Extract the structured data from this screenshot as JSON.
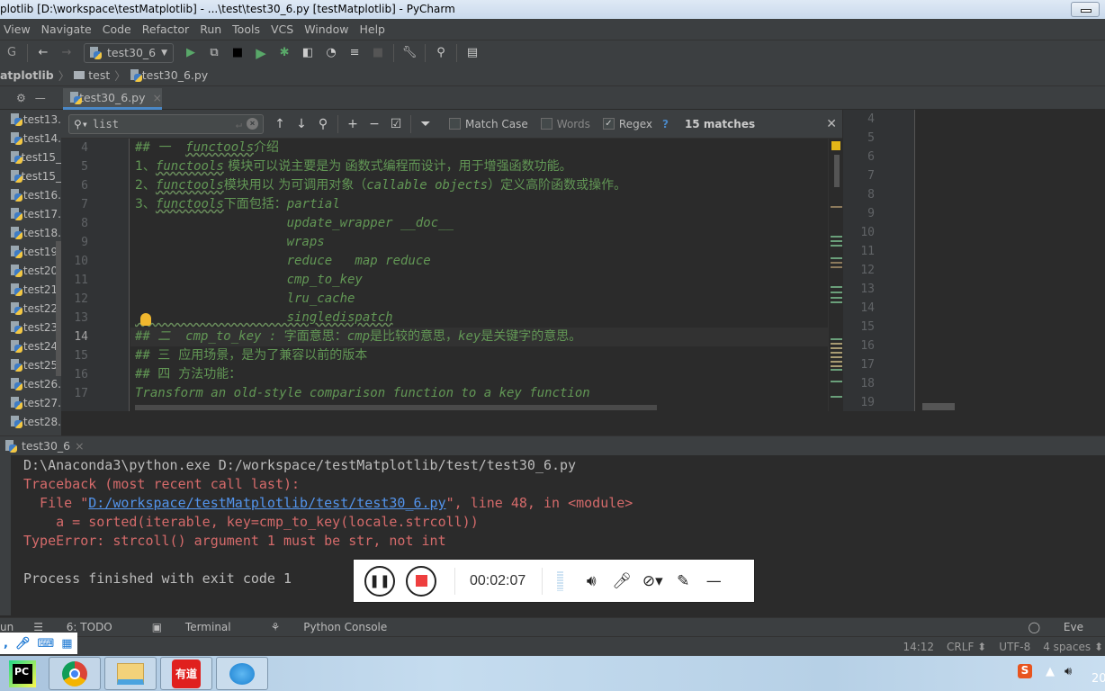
{
  "window": {
    "title": "plotlib [D:\\workspace\\testMatplotlib] - ...\\test\\test30_6.py [testMatplotlib] - PyCharm"
  },
  "menu": [
    "View",
    "Navigate",
    "Code",
    "Refactor",
    "Run",
    "Tools",
    "VCS",
    "Window",
    "Help"
  ],
  "toolbar": {
    "run_config": "test30_6",
    "icons": [
      "back-icon",
      "forward-icon",
      "run-config-icon",
      "resume-icon",
      "screen-icon",
      "stop-icon",
      "run-icon",
      "debug-icon",
      "coverage-icon",
      "profile-icon",
      "concurrency-icon",
      "stop-disabled-icon",
      "wrench-icon",
      "search-icon",
      "structure-icon"
    ]
  },
  "breadcrumb": [
    "atplotlib",
    "test",
    "test30_6.py"
  ],
  "editor_tab": {
    "label": "test30_6.py"
  },
  "project_files": [
    "test13.",
    "test14.",
    "test15_",
    "test15_",
    "test16.",
    "test17.",
    "test18.",
    "test19.",
    "test20.",
    "test21.",
    "test22.",
    "test23.",
    "test24.",
    "test25.",
    "test26.",
    "test27.",
    "test28."
  ],
  "find": {
    "query": "list",
    "match_case_label": "Match Case",
    "match_case": false,
    "words_label": "Words",
    "words": false,
    "regex_label": "Regex",
    "regex": true,
    "help": "?",
    "matches": "15 matches"
  },
  "editor": {
    "line_numbers": [
      "4",
      "5",
      "6",
      "7",
      "8",
      "9",
      "10",
      "11",
      "12",
      "13",
      "14",
      "15",
      "16",
      "17"
    ],
    "current_line": "14",
    "lines": [
      {
        "parts": [
          {
            "t": "## 一  "
          },
          {
            "t": "functools",
            "u": true
          },
          {
            "t": "介绍",
            "cn": true
          }
        ]
      },
      {
        "parts": [
          {
            "t": "1、",
            "cn": true
          },
          {
            "t": "functools",
            "u": true
          },
          {
            "t": " 模块可以说主要是为 函数式编程而设计，用于增强函数功能。",
            "cn": true
          }
        ]
      },
      {
        "parts": [
          {
            "t": "2、",
            "cn": true
          },
          {
            "t": "functools",
            "u": true
          },
          {
            "t": "模块用以 为可调用对象（",
            "cn": true
          },
          {
            "t": "callable objects"
          },
          {
            "t": "）定义高阶函数或操作。",
            "cn": true
          }
        ]
      },
      {
        "parts": [
          {
            "t": "3、",
            "cn": true
          },
          {
            "t": "functools",
            "u": true
          },
          {
            "t": "下面包括：",
            "cn": true
          },
          {
            "t": "partial"
          }
        ]
      },
      {
        "parts": [
          {
            "t": "                    update_wrapper __doc__"
          }
        ]
      },
      {
        "parts": [
          {
            "t": "                    wraps"
          }
        ]
      },
      {
        "parts": [
          {
            "t": "                    reduce   map reduce"
          }
        ]
      },
      {
        "parts": [
          {
            "t": "                    cmp_to_key"
          }
        ]
      },
      {
        "parts": [
          {
            "t": "                    lru_cache"
          }
        ]
      },
      {
        "parts": [
          {
            "t": "                    singledispatch",
            "u": true
          }
        ]
      },
      {
        "parts": [
          {
            "t": "## 二  cmp_to_key : "
          },
          {
            "t": "字面意思：",
            "cn": true
          },
          {
            "t": "cmp"
          },
          {
            "t": "是比较的意思，",
            "cn": true
          },
          {
            "t": "key"
          },
          {
            "t": "是关键字的意思。",
            "cn": true
          }
        ]
      },
      {
        "parts": [
          {
            "t": "## "
          },
          {
            "t": "三  应用场景，是为了兼容以前的版本",
            "cn": true
          }
        ]
      },
      {
        "parts": [
          {
            "t": "## "
          },
          {
            "t": "四  方法功能：",
            "cn": true
          }
        ]
      },
      {
        "parts": [
          {
            "t": "Transform an old-style comparison function to a key function"
          }
        ]
      }
    ],
    "right_line_numbers": [
      "4",
      "5",
      "6",
      "7",
      "8",
      "9",
      "10",
      "11",
      "12",
      "13",
      "14",
      "15",
      "16",
      "17",
      "18",
      "19"
    ]
  },
  "run": {
    "tab_label": "test30_6",
    "output": [
      {
        "cls": "norm",
        "parts": [
          {
            "t": "D:\\Anaconda3\\python.exe D:/workspace/testMatplotlib/test/test30_6.py"
          }
        ]
      },
      {
        "cls": "err",
        "parts": [
          {
            "t": "Traceback (most recent call last):"
          }
        ]
      },
      {
        "cls": "err",
        "parts": [
          {
            "t": "  File \""
          },
          {
            "t": "D:/workspace/testMatplotlib/test/test30_6.py",
            "link": true
          },
          {
            "t": "\", line 48, in <module>"
          }
        ]
      },
      {
        "cls": "err",
        "parts": [
          {
            "t": "    a = sorted(iterable, key=cmp_to_key(locale.strcoll))"
          }
        ]
      },
      {
        "cls": "err",
        "parts": [
          {
            "t": "TypeError: strcoll() argument 1 must be str, not int"
          }
        ]
      },
      {
        "cls": "norm",
        "parts": [
          {
            "t": ""
          }
        ]
      },
      {
        "cls": "norm",
        "parts": [
          {
            "t": "Process finished with exit code 1"
          }
        ]
      }
    ]
  },
  "recorder": {
    "time": "00:02:07"
  },
  "bottom_tools": [
    "un",
    "6: TODO",
    "Terminal",
    "Python Console"
  ],
  "event_log": "Eve",
  "status": {
    "position": "14:12",
    "line_sep": "CRLF",
    "encoding": "UTF-8",
    "indent": "4 spaces"
  },
  "taskbar": {
    "apps": [
      "pycharm-icon",
      "chrome-icon",
      "explorer-icon",
      "youdao-icon",
      "video-icon"
    ],
    "youdao_label": "有道",
    "clock": "20"
  },
  "colors": {
    "comment_green": "#629755",
    "error_red": "#d46a6a",
    "link_blue": "#5394ec",
    "accent_blue": "#4a88c7"
  }
}
